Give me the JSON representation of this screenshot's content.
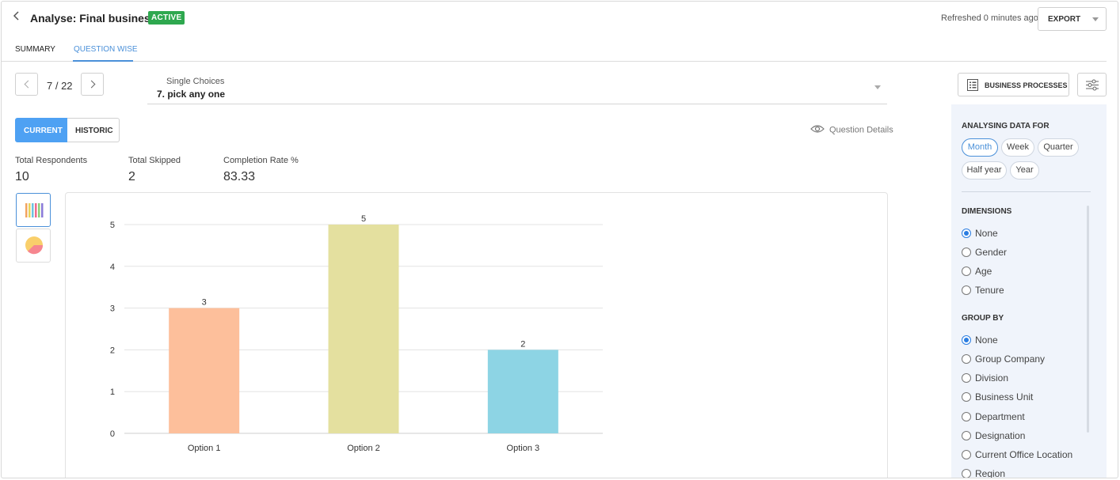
{
  "header": {
    "title": "Analyse: Final business",
    "status_badge": "ACTIVE",
    "refreshed_text": "Refreshed 0 minutes ago",
    "export_label": "EXPORT"
  },
  "tabs": [
    {
      "label": "SUMMARY",
      "active": false
    },
    {
      "label": "QUESTION WISE",
      "active": true
    }
  ],
  "question_nav": {
    "pager": "7 / 22",
    "question_type": "Single Choices",
    "question_text": "7. pick any one"
  },
  "view_toggle": {
    "current_label": "CURRENT",
    "historic_label": "HISTORIC"
  },
  "question_details_label": "Question Details",
  "stats": [
    {
      "label": "Total Respondents",
      "value": "10"
    },
    {
      "label": "Total Skipped",
      "value": "2"
    },
    {
      "label": "Completion Rate %",
      "value": "83.33"
    }
  ],
  "chart_type_selector": [
    {
      "icon": "bar-chart-icon",
      "active": true
    },
    {
      "icon": "pie-chart-icon",
      "active": false
    }
  ],
  "right_panel": {
    "business_processes_label": "BUSINESS PROCESSES",
    "analysing_heading": "ANALYSING DATA FOR",
    "periods": [
      "Month",
      "Week",
      "Quarter",
      "Half year",
      "Year"
    ],
    "selected_period": "Month",
    "dimensions_heading": "DIMENSIONS",
    "dimensions": [
      "None",
      "Gender",
      "Age",
      "Tenure"
    ],
    "selected_dimension": "None",
    "group_by_heading": "GROUP BY",
    "group_by": [
      "None",
      "Group Company",
      "Division",
      "Business Unit",
      "Department",
      "Designation",
      "Current Office Location",
      "Region"
    ],
    "selected_group_by": "None"
  },
  "colors": {
    "accent": "#4a90d9",
    "badge": "#2ea84f",
    "bar_colors": [
      "#fdbf9b",
      "#e4e09f",
      "#8dd4e4"
    ]
  },
  "chart_data": {
    "type": "bar",
    "categories": [
      "Option 1",
      "Option 2",
      "Option 3"
    ],
    "values": [
      3,
      5,
      2
    ],
    "data_labels": [
      "3",
      "5",
      "2"
    ],
    "y_ticks": [
      "0",
      "1",
      "2",
      "3",
      "4",
      "5"
    ],
    "ylim": [
      0,
      5
    ],
    "grid": true,
    "title": "",
    "xlabel": "",
    "ylabel": ""
  }
}
